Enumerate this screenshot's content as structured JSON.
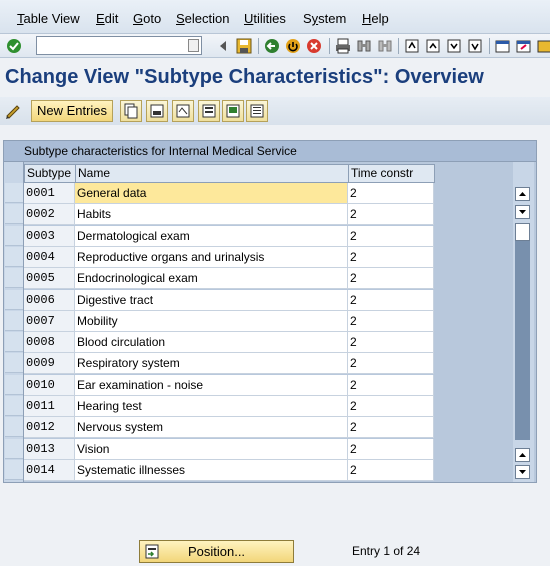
{
  "menu": [
    {
      "label": "Table View",
      "ul": "T"
    },
    {
      "label": "Edit",
      "ul": "E"
    },
    {
      "label": "Goto",
      "ul": "G"
    },
    {
      "label": "Selection",
      "ul": "S"
    },
    {
      "label": "Utilities",
      "ul": "U"
    },
    {
      "label": "System",
      "ul": "y"
    },
    {
      "label": "Help",
      "ul": "H"
    }
  ],
  "command_field": {
    "value": "",
    "placeholder": ""
  },
  "title": "Change View \"Subtype Characteristics\": Overview",
  "app_toolbar": {
    "new_entries_label": "New Entries"
  },
  "table": {
    "title": "Subtype characteristics for Internal Medical Service",
    "columns": [
      "Subtype",
      "Name",
      "Time constr"
    ],
    "rows": [
      {
        "code": "0001",
        "name": "General data",
        "time": "2"
      },
      {
        "code": "0002",
        "name": "Habits",
        "time": "2"
      },
      {
        "code": "0003",
        "name": "Dermatological exam",
        "time": "2"
      },
      {
        "code": "0004",
        "name": "Reproductive organs and urinalysis",
        "time": "2"
      },
      {
        "code": "0005",
        "name": "Endocrinological exam",
        "time": "2"
      },
      {
        "code": "0006",
        "name": "Digestive tract",
        "time": "2"
      },
      {
        "code": "0007",
        "name": "Mobility",
        "time": "2"
      },
      {
        "code": "0008",
        "name": "Blood circulation",
        "time": "2"
      },
      {
        "code": "0009",
        "name": "Respiratory system",
        "time": "2"
      },
      {
        "code": "0010",
        "name": "Ear examination - noise",
        "time": "2"
      },
      {
        "code": "0011",
        "name": "Hearing test",
        "time": "2"
      },
      {
        "code": "0012",
        "name": "Nervous system",
        "time": "2"
      },
      {
        "code": "0013",
        "name": "Vision",
        "time": "2"
      },
      {
        "code": "0014",
        "name": "Systematic illnesses",
        "time": "2"
      }
    ]
  },
  "footer": {
    "position_label": "Position...",
    "entry_text": "Entry 1 of 24"
  },
  "colors": {
    "title": "#1b3f7d",
    "highlight": "#fde89b",
    "button": "#f2d67a"
  }
}
